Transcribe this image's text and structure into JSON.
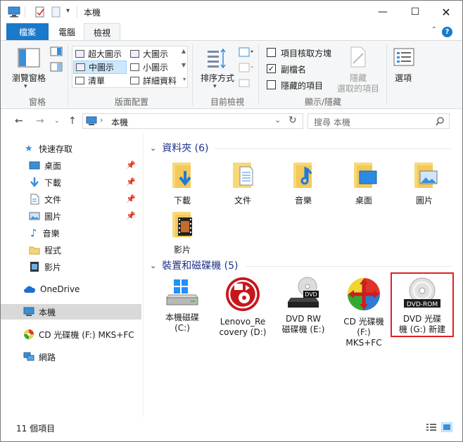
{
  "window": {
    "title": "本機"
  },
  "tabs": {
    "file": "檔案",
    "computer": "電腦",
    "view": "檢視"
  },
  "ribbon": {
    "panes": {
      "nav_pane": "瀏覽窗格",
      "group": "窗格"
    },
    "layout": {
      "items": [
        "超大圖示",
        "大圖示",
        "中圖示",
        "小圖示",
        "清單",
        "詳細資料"
      ],
      "selected": "中圖示",
      "group": "版面配置"
    },
    "current_view": {
      "sort": "排序方式",
      "group": "目前檢視"
    },
    "show_hide": {
      "item_checkboxes": "項目核取方塊",
      "file_extensions": "副檔名",
      "hidden_items": "隱藏的項目",
      "hide_selected": "隱藏",
      "hide_selected_2": "選取的項目",
      "group": "顯示/隱藏"
    },
    "options": {
      "label": "選項"
    }
  },
  "address": {
    "path": "本機",
    "search_placeholder": "搜尋 本機"
  },
  "sidebar": {
    "quick_access": "快速存取",
    "items": [
      "桌面",
      "下載",
      "文件",
      "圖片",
      "音樂",
      "程式",
      "影片"
    ],
    "onedrive": "OneDrive",
    "this_pc": "本機",
    "cd_drive": "CD 光碟機 (F:) MKS+FC",
    "network": "網路"
  },
  "content": {
    "folders_header": "資料夾 (6)",
    "folders": [
      "下載",
      "文件",
      "音樂",
      "桌面",
      "圖片",
      "影片"
    ],
    "devices_header": "裝置和磁碟機 (5)",
    "devices": [
      {
        "line1": "本機磁碟",
        "line2": "(C:)",
        "line3": ""
      },
      {
        "line1": "Lenovo_Re",
        "line2": "covery (D:)",
        "line3": ""
      },
      {
        "line1": "DVD RW",
        "line2": "磁碟機 (E:)",
        "line3": ""
      },
      {
        "line1": "CD 光碟機",
        "line2": "(F:)",
        "line3": "MKS+FC"
      },
      {
        "line1": "DVD 光碟",
        "line2": "機 (G:) 新建",
        "line3": ""
      }
    ],
    "dvd_label": "DVD",
    "dvdrom_label": "DVD-ROM"
  },
  "status": {
    "count": "11 個項目"
  },
  "colors": {
    "accent": "#1979ca",
    "highlight": "#e02020"
  }
}
